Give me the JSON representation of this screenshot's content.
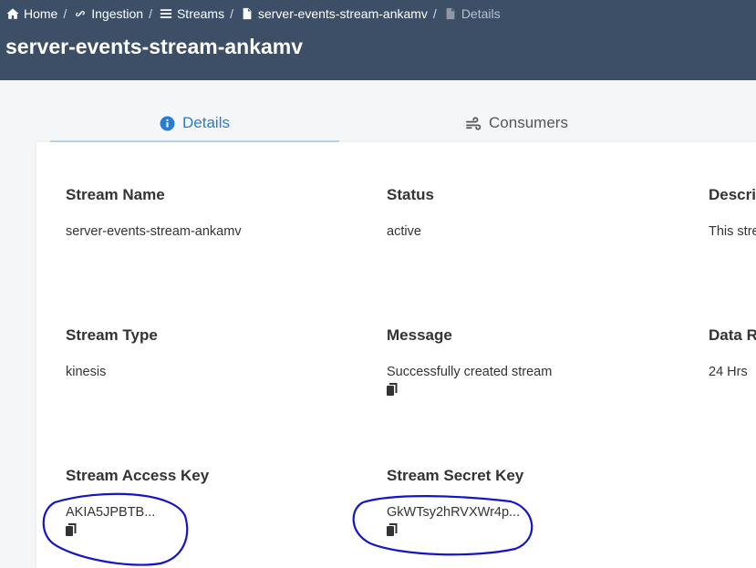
{
  "breadcrumb": [
    {
      "label": "Home",
      "icon": "home-icon"
    },
    {
      "label": "Ingestion",
      "icon": "link-icon"
    },
    {
      "label": "Streams",
      "icon": "list-icon"
    },
    {
      "label": "server-events-stream-ankamv",
      "icon": "file-icon"
    },
    {
      "label": "Details",
      "icon": "file-icon",
      "current": true
    }
  ],
  "breadcrumb_separator": "/",
  "page_title": "server-events-stream-ankamv",
  "tabs": [
    {
      "label": "Details",
      "icon": "info-circle-icon",
      "active": true
    },
    {
      "label": "Consumers",
      "icon": "wind-icon",
      "active": false
    }
  ],
  "fields": {
    "stream_name": {
      "label": "Stream Name",
      "value": "server-events-stream-ankamv"
    },
    "status": {
      "label": "Status",
      "value": "active"
    },
    "description": {
      "label": "Descri",
      "value": "This stre"
    },
    "stream_type": {
      "label": "Stream Type",
      "value": "kinesis"
    },
    "message": {
      "label": "Message",
      "value": "Successfully created stream"
    },
    "data_retention": {
      "label": "Data R",
      "value": "24 Hrs"
    },
    "access_key": {
      "label": "Stream Access Key",
      "value": "AKIA5JPBTB..."
    },
    "secret_key": {
      "label": "Stream Secret Key",
      "value": "GkWTsy2hRVXWr4p..."
    }
  },
  "colors": {
    "header_bg": "#3c4f66",
    "accent": "#2a7ccf",
    "annotation": "#1414c8"
  }
}
